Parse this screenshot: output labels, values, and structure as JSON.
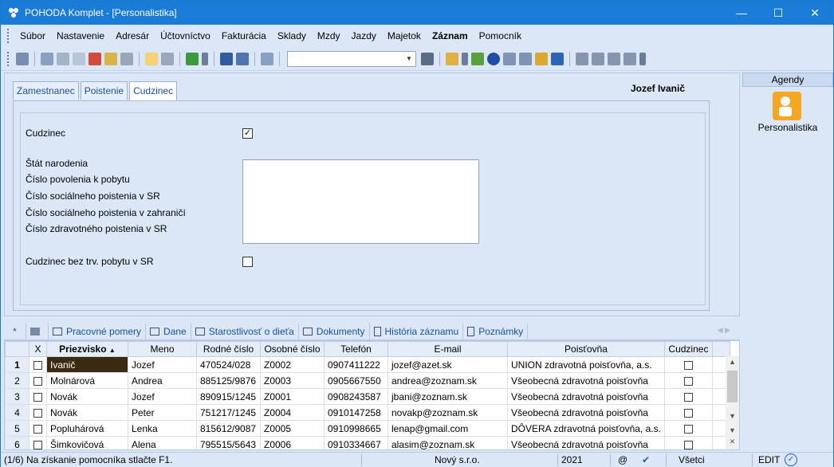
{
  "window": {
    "title": "POHODA Komplet - [Personalistika]"
  },
  "menu": [
    "Súbor",
    "Nastavenie",
    "Adresár",
    "Účtovníctvo",
    "Fakturácia",
    "Sklady",
    "Mzdy",
    "Jazdy",
    "Majetok",
    "Záznam",
    "Pomocník"
  ],
  "form": {
    "tabs": [
      "Zamestnanec",
      "Poistenie",
      "Cudzinec"
    ],
    "person_name": "Jozef Ivanič",
    "cudzinec_label": "Cudzinec",
    "cudzinec_checked": true,
    "fields": [
      "Štát narodenia",
      "Číslo povolenia k pobytu",
      "Číslo sociálneho poistenia v SR",
      "Číslo sociálneho poistenia v zahraničí",
      "Číslo zdravotného poistenia v SR"
    ],
    "bez_pobytu_label": "Cudzinec bez trv. pobytu v SR",
    "bez_pobytu_checked": false
  },
  "agenda": {
    "header": "Agendy",
    "label": "Personalistika"
  },
  "lower_tabs": [
    "*",
    "",
    "Pracovné pomery",
    "Dane",
    "Starostlivosť o dieťa",
    "Dokumenty",
    "História záznamu",
    "Poznámky"
  ],
  "grid": {
    "columns": [
      "",
      "X",
      "Priezvisko",
      "Meno",
      "Rodné číslo",
      "Osobné číslo",
      "Telefón",
      "E-mail",
      "Poisťovňa",
      "Cudzinec"
    ],
    "rows": [
      [
        "1",
        "Ivanič",
        "Jozef",
        "470524/028",
        "Z0002",
        "0907411222",
        "jozef@azet.sk",
        "UNION zdravotná poisťovňa, a.s."
      ],
      [
        "2",
        "Molnárová",
        "Andrea",
        "885125/9876",
        "Z0003",
        "0905667550",
        "andrea@zoznam.sk",
        "Všeobecná zdravotná poisťovňa"
      ],
      [
        "3",
        "Novák",
        "Jozef",
        "890915/1245",
        "Z0001",
        "0908243587",
        "jbani@zoznam.sk",
        "Všeobecná zdravotná poisťovňa"
      ],
      [
        "4",
        "Novák",
        "Peter",
        "751217/1245",
        "Z0004",
        "0910147258",
        "novakp@zoznam.sk",
        "Všeobecná zdravotná poisťovňa"
      ],
      [
        "5",
        "Popluhárová",
        "Lenka",
        "815612/9087",
        "Z0005",
        "0910998665",
        "lenap@gmail.com",
        "DÔVERA zdravotná poisťovňa, a.s."
      ],
      [
        "6",
        "Šimkovičová",
        "Alena",
        "795515/5643",
        "Z0006",
        "0910334667",
        "alasim@zoznam.sk",
        "Všeobecná zdravotná poisťovňa"
      ]
    ]
  },
  "status": {
    "hint": "(1/6) Na získanie pomocníka stlačte F1.",
    "company": "Nový s.r.o.",
    "year": "2021",
    "at": "@",
    "filter": "Všetci",
    "mode": "EDIT"
  }
}
